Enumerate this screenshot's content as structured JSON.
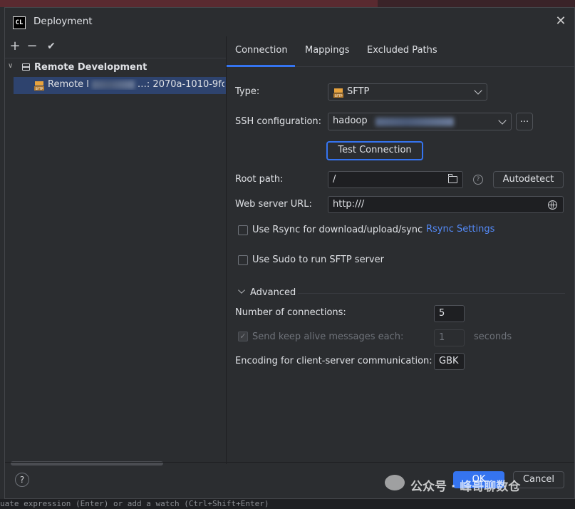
{
  "dialog": {
    "app_icon": "CL",
    "title": "Deployment",
    "close_glyph": "✕"
  },
  "left_toolbar": {
    "add_glyph": "+",
    "remove_glyph": "−",
    "check_glyph": "✔"
  },
  "tree": {
    "root_label": "Remote Development",
    "child_label_prefix": "Remote l",
    "child_label_suffix": "…: 2070a-1010-9fc"
  },
  "tabs": [
    {
      "label": "Connection",
      "active": true
    },
    {
      "label": "Mappings",
      "active": false
    },
    {
      "label": "Excluded Paths",
      "active": false
    }
  ],
  "connection": {
    "type_label": "Type:",
    "type_value": "SFTP",
    "ssh_label": "SSH configuration:",
    "ssh_value": "hadoop",
    "ssh_more": "...",
    "test_button": "Test Connection",
    "root_label": "Root path:",
    "root_value": "/",
    "autodetect_button": "Autodetect",
    "web_label": "Web server URL:",
    "web_value": "http:///",
    "rsync_label": "Use Rsync for download/upload/sync",
    "rsync_checked": false,
    "rsync_link": "Rsync Settings",
    "sudo_label": "Use Sudo to run SFTP server",
    "sudo_checked": false
  },
  "advanced": {
    "title": "Advanced",
    "connections_label": "Number of connections:",
    "connections_value": "5",
    "keepalive_label": "Send keep alive messages each:",
    "keepalive_value": "1",
    "keepalive_unit": "seconds",
    "keepalive_checked": true,
    "encoding_label": "Encoding for client-server communication:",
    "encoding_value": "GBK"
  },
  "footer": {
    "help_glyph": "?",
    "ok_label": "OK",
    "cancel_label": "Cancel"
  },
  "watermark": "公众号 · 峰哥聊数仓",
  "status_bar": "uate expression (Enter) or add a watch (Ctrl+Shift+Enter)",
  "colors": {
    "accent": "#3574f0",
    "link": "#548af7",
    "background": "#2b2d30"
  }
}
